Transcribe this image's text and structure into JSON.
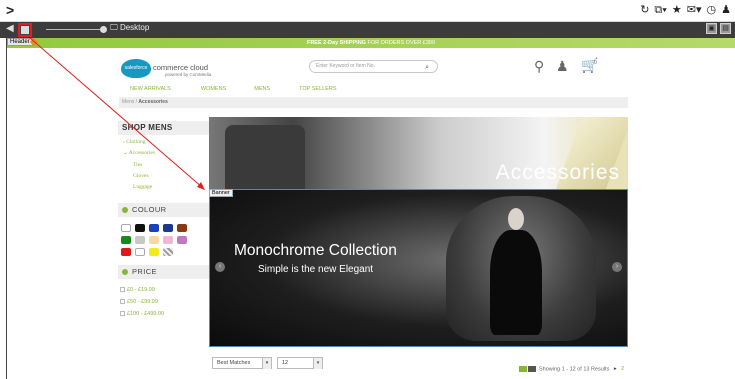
{
  "browser": {
    "nav_chevron": ">",
    "toolbar_icons": [
      "refresh-icon",
      "external-link-icon",
      "star-icon",
      "email-icon",
      "clock-icon",
      "profile-icon"
    ]
  },
  "preview_toolbar": {
    "back_glyph": "◀",
    "device_label": "Desktop",
    "header_tag": "Header"
  },
  "promo": {
    "bold": "FREE 2-Day SHIPPING",
    "rest": " FOR ORDERS OVER £300"
  },
  "header": {
    "logo_text": "salesforce",
    "brand": "commerce cloud",
    "brand_sub": "powered by ComMedia",
    "search_placeholder": "Enter Keyword or Item No.",
    "cart_count": "0"
  },
  "nav": {
    "items": [
      "NEW ARRIVALS",
      "WOMENS",
      "MENS",
      "TOP SELLERS"
    ]
  },
  "breadcrumb": {
    "root": "Mens",
    "sep": " / ",
    "current": "Accessories"
  },
  "left_nav": {
    "title": "SHOP MENS",
    "categories": [
      {
        "label": "Clothing",
        "prefix": "›"
      },
      {
        "label": "Accessories",
        "prefix": "⌄"
      }
    ],
    "subcategories": [
      "Ties",
      "Gloves",
      "Luggage"
    ],
    "colour_heading": "COLOUR",
    "swatches": [
      "#ffffff",
      "#111111",
      "#1a3fbf",
      "#1b3a8f",
      "#8a3a12",
      "#168a1a",
      "#c8c8c8",
      "#f5d9a0",
      "#f2b6d6",
      "#c079c0",
      "#e01818",
      "#ffffff",
      "#f2ea1a",
      "#c8c8c8"
    ],
    "price_heading": "PRICE",
    "prices": [
      "£0 - £19.99",
      "£50 - £99.99",
      "£100 - £499.00"
    ]
  },
  "category_banner": {
    "title": "Accessories"
  },
  "banner": {
    "tag": "Banner",
    "headline": "Monochrome Collection",
    "subline": "Simple is the new Elegant",
    "prev": "‹",
    "next": "›"
  },
  "sort": {
    "selected": "Best Matches",
    "page_size": "12"
  },
  "results": {
    "text": "Showing 1 - 12 of 13 Results",
    "next_arrow": "▸",
    "next_page": "2"
  }
}
